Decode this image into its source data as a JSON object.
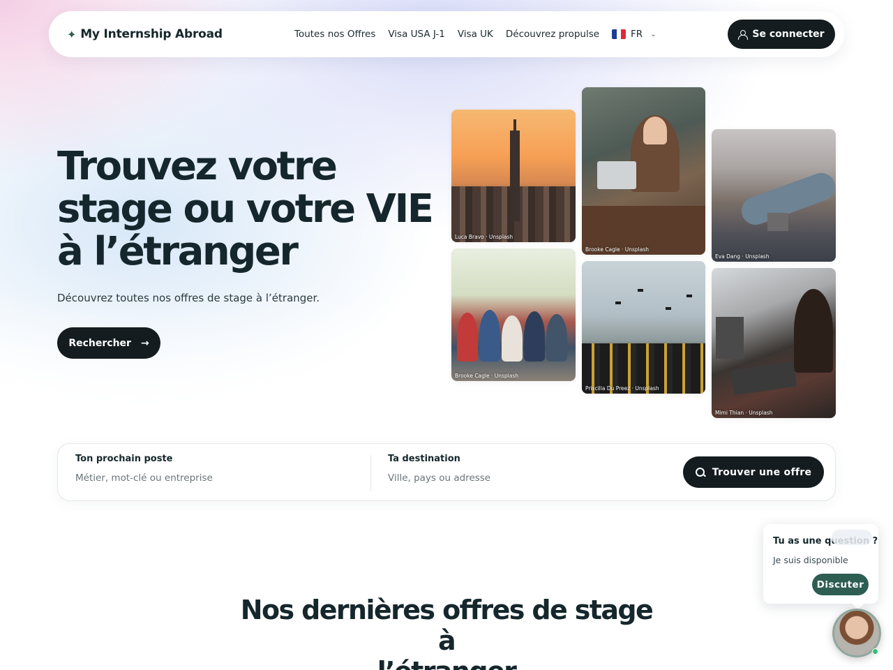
{
  "nav": {
    "brand": "My Internship Abroad",
    "links": [
      "Toutes nos Offres",
      "Visa USA J-1",
      "Visa UK",
      "Découvrez propulse"
    ],
    "lang": "FR",
    "login_label": "Se connecter"
  },
  "hero": {
    "title_lines": [
      "Trouvez votre",
      "stage ou votre VIE",
      "à l’étranger"
    ],
    "subtitle": "Découvrez toutes nos offres de stage à l’étranger.",
    "cta_label": "Rechercher",
    "cta_arrow": "→"
  },
  "photos": [
    {
      "credit": "Luca Bravo · Unsplash"
    },
    {
      "credit": "Brooke Cagle · Unsplash"
    },
    {
      "credit": "Eva Dang · Unsplash"
    },
    {
      "credit": "Brooke Cagle · Unsplash"
    },
    {
      "credit": "Priscilla Du Preez · Unsplash"
    },
    {
      "credit": "Mimi Thian · Unsplash"
    }
  ],
  "search": {
    "job_label": "Ton prochain poste",
    "job_placeholder": "Métier, mot-clé ou entreprise",
    "dest_label": "Ta destination",
    "dest_placeholder": "Ville, pays ou adresse",
    "submit_label": "Trouver une offre"
  },
  "section": {
    "title_lines": [
      "Nos dernières offres de stage à",
      "l’étranger"
    ]
  },
  "chat": {
    "question": "Tu as une question ?",
    "status": "Je suis disponible",
    "button_label": "Discuter"
  },
  "colors": {
    "primary_dark": "#141c1f",
    "chat_green": "#2e5e52",
    "online": "#2fbf71"
  }
}
